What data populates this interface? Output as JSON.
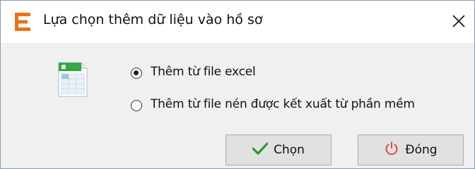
{
  "dialog": {
    "title": "Lựa chọn thêm dữ liệu vào hồ sơ",
    "app_icon": "app-e-logo-icon",
    "close_icon": "close-icon",
    "accent_color": "#e8731a"
  },
  "options": [
    {
      "label": "Thêm từ file excel",
      "selected": true
    },
    {
      "label": "Thêm từ file nén được kết xuất từ phần mềm",
      "selected": false
    }
  ],
  "buttons": {
    "ok": {
      "label": "Chọn",
      "icon": "checkmark-icon",
      "icon_color": "#2e9a2e"
    },
    "close": {
      "label": "Đóng",
      "icon": "power-icon",
      "icon_color": "#e03a3a"
    }
  }
}
